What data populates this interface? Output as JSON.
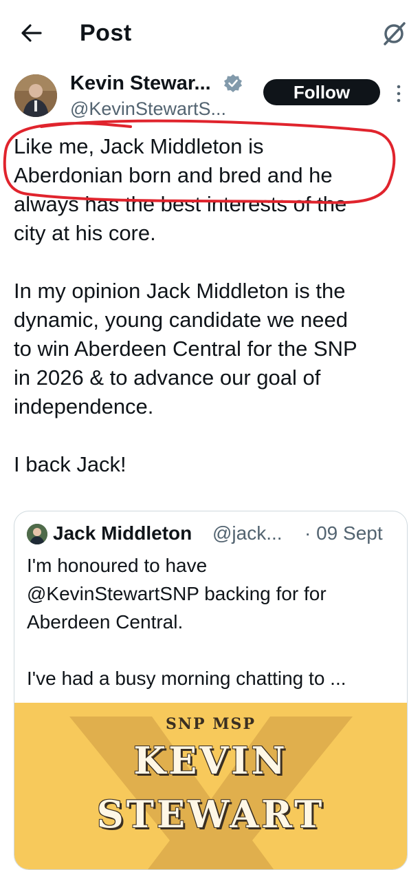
{
  "header": {
    "title": "Post",
    "back_icon": "arrow-left-icon",
    "grok_icon": "grok-icon"
  },
  "post": {
    "author_name": "Kevin Stewar...",
    "author_handle": "@KevinStewartS...",
    "verified_icon": "verified-badge-icon",
    "follow_label": "Follow",
    "more_icon": "more-vertical-icon",
    "text": "Like me, Jack Middleton is\nAberdonian born and bred and he\nalways has the best interests of the\ncity at his core.\n\nIn my opinion Jack Middleton is the\ndynamic, young candidate we need\nto win Aberdeen Central for the SNP\nin 2026 & to advance our goal of\nindependence.\n\nI back Jack!",
    "annotation_color": "#e0242d"
  },
  "quoted_post": {
    "author_name": "Jack Middleton",
    "author_handle": "@jack...",
    "date": "· 09 Sept",
    "text": "I'm honoured to have\n@KevinStewartSNP backing for  for\nAberdeen Central.\n\nI've had a busy morning chatting to ...",
    "media": {
      "subtitle": "SNP MSP",
      "name_line1": "KEVIN",
      "name_line2": "STEWART",
      "background_color": "#f7c95b"
    }
  },
  "colors": {
    "text_primary": "#0f1419",
    "text_secondary": "#536471",
    "verified_blue": "#829aab",
    "border": "#cfd9de"
  }
}
